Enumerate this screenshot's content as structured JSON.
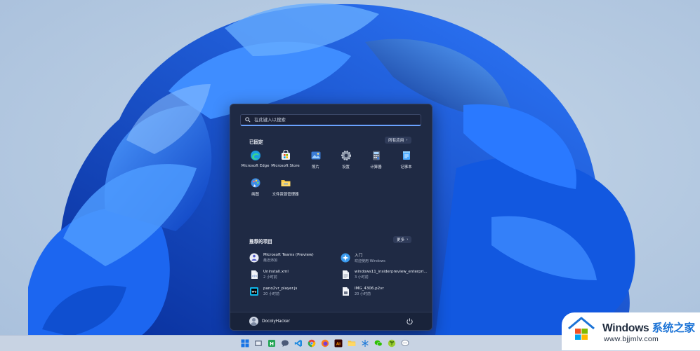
{
  "search": {
    "placeholder": "在此键入以搜索"
  },
  "pinned": {
    "title": "已固定",
    "all_apps_label": "所有应用",
    "apps": [
      {
        "label": "Microsoft Edge",
        "icon": "edge-icon"
      },
      {
        "label": "Microsoft Store",
        "icon": "store-icon"
      },
      {
        "label": "照片",
        "icon": "photos-icon"
      },
      {
        "label": "设置",
        "icon": "settings-gear-icon"
      },
      {
        "label": "计算器",
        "icon": "calculator-icon"
      },
      {
        "label": "记事本",
        "icon": "notepad-icon"
      },
      {
        "label": "画图",
        "icon": "paint-icon"
      },
      {
        "label": "文件资源管理器",
        "icon": "file-explorer-icon"
      }
    ]
  },
  "recommended": {
    "title": "推荐的项目",
    "more_label": "更多",
    "items": [
      {
        "name": "Microsoft Teams (Preview)",
        "sub": "最近添加",
        "icon": "teams-icon"
      },
      {
        "name": "入门",
        "sub": "欢迎使用 Windows",
        "icon": "get-started-icon"
      },
      {
        "name": "Uninstall.xml",
        "sub": "2 小时前",
        "icon": "xml-file-icon"
      },
      {
        "name": "windows11_insiderpreview_enterpri...",
        "sub": "3 小时前",
        "icon": "document-file-icon"
      },
      {
        "name": "pano2vr_player.js",
        "sub": "20 小时前",
        "icon": "webstorm-file-icon"
      },
      {
        "name": "IMG_4306.p2vr",
        "sub": "20 小时前",
        "icon": "generic-file-icon"
      }
    ]
  },
  "user": {
    "name": "DocolyHacker"
  },
  "taskbar": {
    "icons": [
      "windows-start-icon",
      "file-manager-icon",
      "app-h-icon",
      "chat-icon",
      "vscode-icon",
      "chrome-icon",
      "firefox-icon",
      "illustrator-icon",
      "folder-icon",
      "snowflake-icon",
      "wechat-icon",
      "sprout-icon",
      "message-bubble-icon"
    ]
  },
  "watermark": {
    "title": "Windows",
    "title_cn": "系统之家",
    "url": "www.bjjmlv.com"
  },
  "colors": {
    "start_bg": "#1f2a44",
    "accent": "#6aa2ff",
    "wallpaper_bloom": "#1763e6"
  }
}
